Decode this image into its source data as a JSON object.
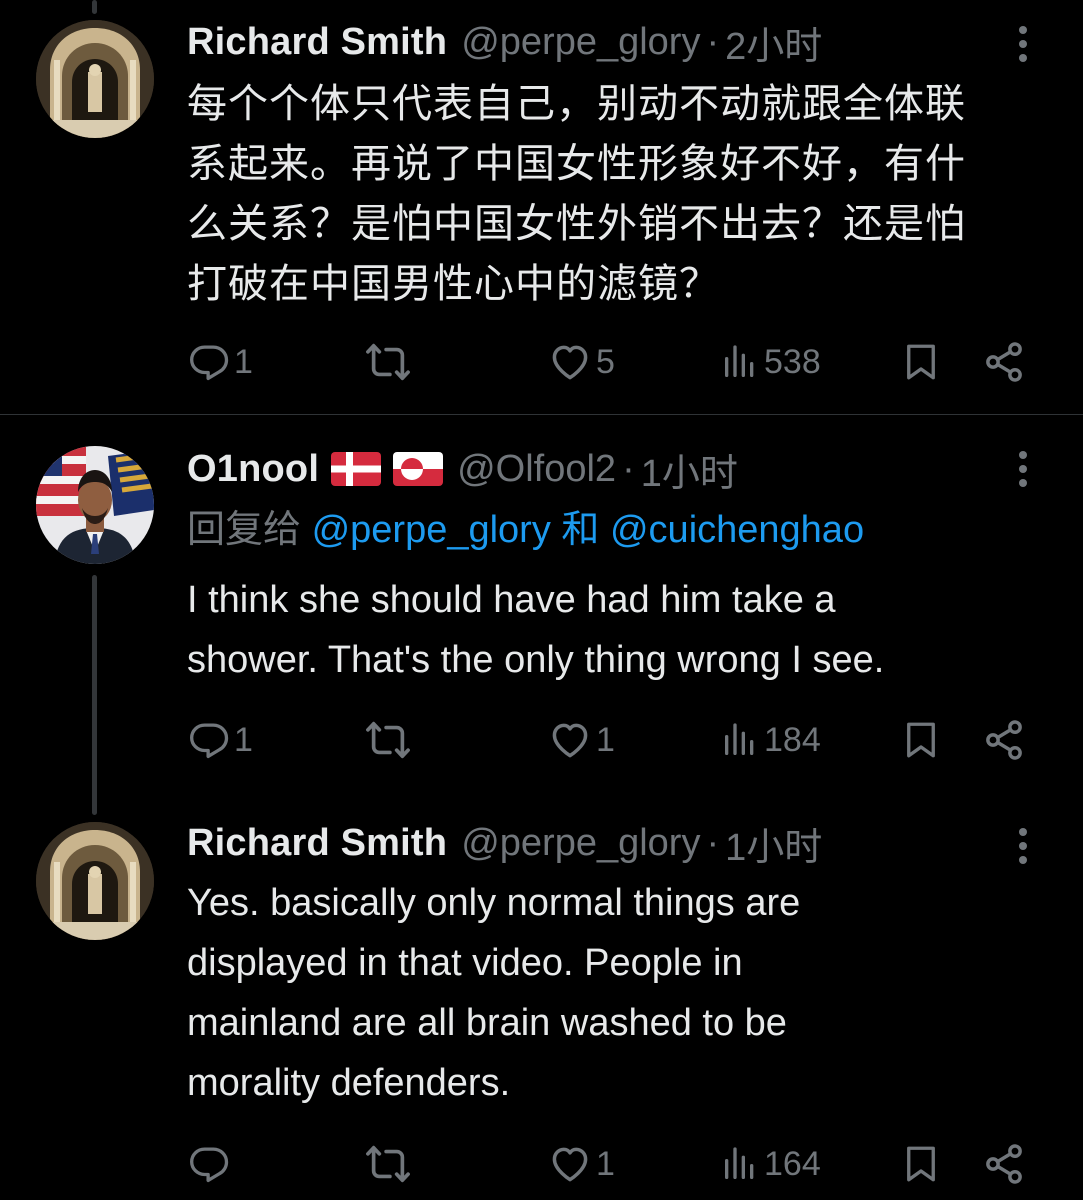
{
  "tweets": [
    {
      "name": "Richard Smith",
      "handle": "@perpe_glory",
      "dot": "·",
      "time": "2小时",
      "text_lines": [
        "每个个体只代表自己，别动不动就跟全体联",
        "系起来。再说了中国女性形象好不好，有什",
        "么关系？是怕中国女性外销不出去？还是怕",
        "打破在中国男性心中的滤镜？"
      ],
      "counts": {
        "reply": "1",
        "retweet": "",
        "like": "5",
        "views": "538"
      }
    },
    {
      "name": "O1nool",
      "flags": [
        "denmark-flag",
        "greenland-flag"
      ],
      "handle": "@Olfool2",
      "dot": "·",
      "time": "1小时",
      "reply_prefix": "回复给",
      "reply_user_1": "@perpe_glory",
      "reply_and": "和",
      "reply_user_2": "@cuichenghao",
      "text_lines": [
        "I think she should have had him take a",
        "shower. That's the only thing wrong I see."
      ],
      "counts": {
        "reply": "1",
        "retweet": "",
        "like": "1",
        "views": "184"
      }
    },
    {
      "name": "Richard Smith",
      "handle": "@perpe_glory",
      "dot": "·",
      "time": "1小时",
      "text_lines": [
        "Yes. basically only normal things are",
        "displayed in that video. People in",
        "mainland are all brain washed to be",
        "morality defenders."
      ],
      "counts": {
        "reply": "",
        "retweet": "",
        "like": "1",
        "views": "164"
      }
    }
  ],
  "colors": {
    "background": "#000000",
    "text": "#e7e9ea",
    "muted": "#71767b",
    "link": "#1d9bf0",
    "divider": "#2f3336"
  },
  "icons": [
    "reply-icon",
    "retweet-icon",
    "like-icon",
    "views-icon",
    "bookmark-icon",
    "share-icon",
    "more-icon"
  ]
}
